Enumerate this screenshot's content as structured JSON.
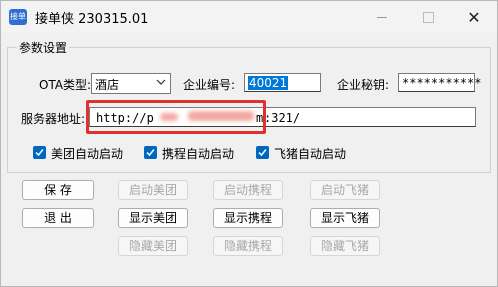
{
  "window": {
    "title": "接单侠 230315.01",
    "app_icon_text": "接单",
    "close_glyph": "✕"
  },
  "group": {
    "legend": "参数设置"
  },
  "ota": {
    "label": "OTA类型:",
    "selected": "酒店"
  },
  "enterprise_code": {
    "label": "企业编号:",
    "value": "40021"
  },
  "enterprise_secret": {
    "label": "企业秘钥:",
    "value": "***********"
  },
  "server": {
    "label": "服务器地址:",
    "value_prefix": "http://p",
    "value_mid": "m",
    "value_suffix": ":321/"
  },
  "checkboxes": [
    {
      "label": "美团自动启动",
      "checked": true
    },
    {
      "label": "携程自动启动",
      "checked": true
    },
    {
      "label": "飞猪自动启动",
      "checked": true
    }
  ],
  "buttons": {
    "save": "保  存",
    "exit": "退  出",
    "start_meituan": "启动美团",
    "start_ctrip": "启动携程",
    "start_fliggy": "启动飞猪",
    "show_meituan": "显示美团",
    "show_ctrip": "显示携程",
    "show_fliggy": "显示飞猪",
    "hide_meituan": "隐藏美团",
    "hide_ctrip": "隐藏携程",
    "hide_fliggy": "隐藏飞猪"
  },
  "colors": {
    "accent": "#0067c0",
    "highlight_box": "#e0322c",
    "selection": "#0078d7"
  }
}
